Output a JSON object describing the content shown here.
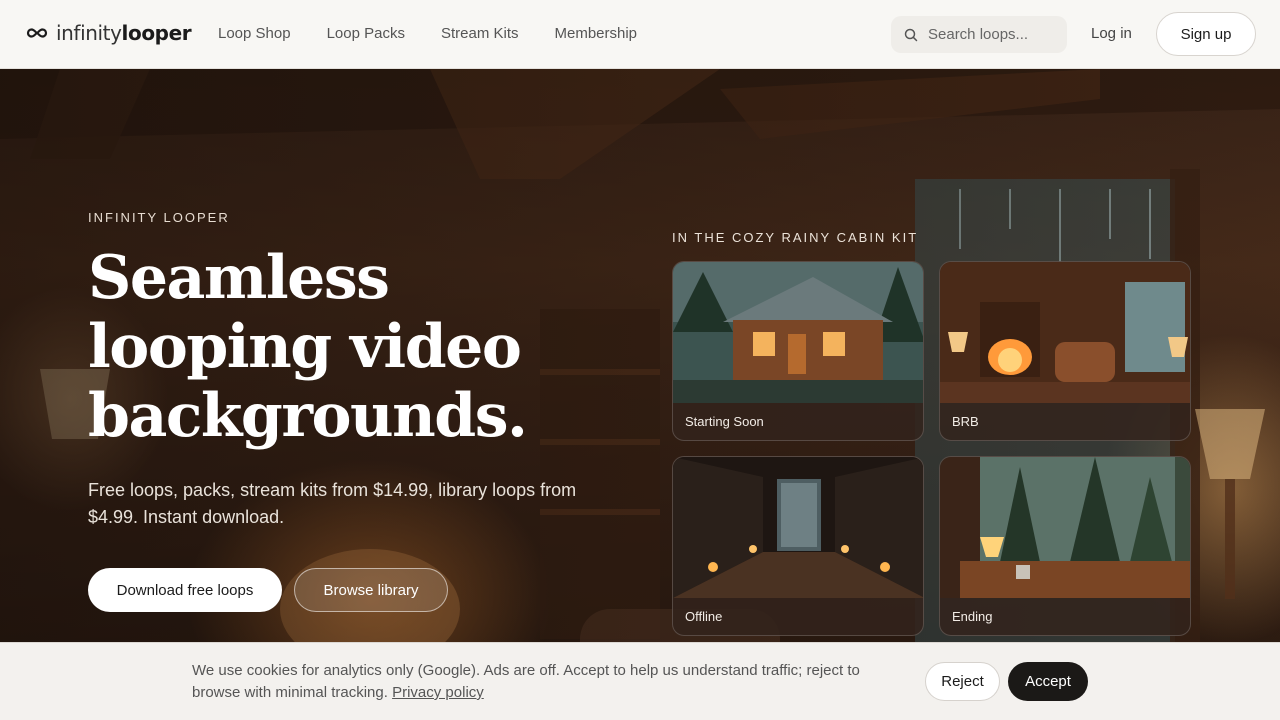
{
  "header": {
    "logo": {
      "light": "infinity",
      "bold": "looper"
    },
    "nav": [
      "Loop Shop",
      "Loop Packs",
      "Stream Kits",
      "Membership"
    ],
    "search": {
      "placeholder": "Search loops..."
    },
    "login_label": "Log in",
    "signup_label": "Sign up"
  },
  "hero": {
    "eyebrow": "INFINITY LOOPER",
    "headline": "Seamless looping video backgrounds.",
    "subline": "Free loops, packs, stream kits from $14.99, library loops from $4.99. Instant download.",
    "primary_cta": "Download free loops",
    "secondary_cta": "Browse library"
  },
  "kit": {
    "label": "IN THE COZY RAINY CABIN KIT",
    "cards": [
      {
        "label": "Starting Soon"
      },
      {
        "label": "BRB"
      },
      {
        "label": "Offline"
      },
      {
        "label": "Ending"
      }
    ]
  },
  "cookie": {
    "text": "We use cookies for analytics only (Google). Ads are off. Accept to help us understand traffic; reject to browse with minimal tracking.",
    "link": "Privacy policy",
    "reject": "Reject",
    "accept": "Accept"
  },
  "colors": {
    "header_bg": "#f8f7f4",
    "accent_dark": "#1b1917",
    "hero_warm": "#4a2d1b"
  }
}
